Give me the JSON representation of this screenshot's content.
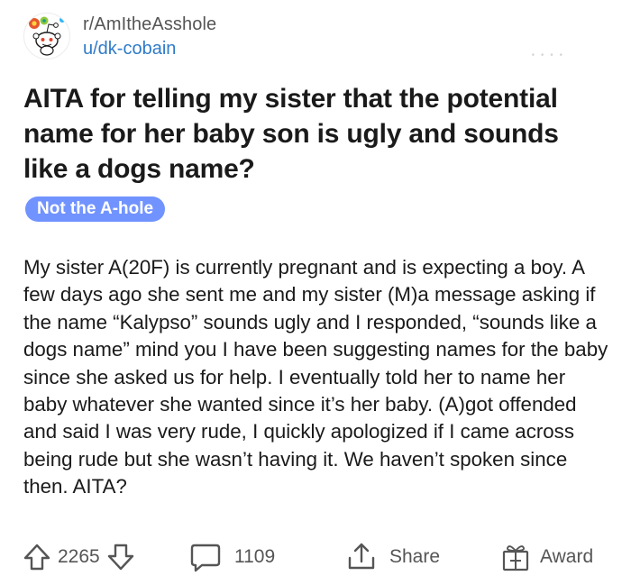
{
  "post": {
    "subreddit": "r/AmItheAsshole",
    "author": "u/dk-cobain",
    "title": "AITA for telling my sister that the potential name for her baby son is ugly and sounds like a dogs name?",
    "flair": "Not the A-hole",
    "body": "My sister A(20F) is currently pregnant and is expecting a boy. A few days ago she sent me and my sister (M)a message asking if the name “Kalypso” sounds ugly and I responded, “sounds like a dogs name” mind you I have been suggesting names for the baby since she asked us for help. I eventually told her to name her baby whatever she wanted since it’s her baby. (A)got offended and said I was very rude, I quickly apologized if I came across being rude but she wasn’t having it. We haven’t spoken since then. AITA?"
  },
  "actions": {
    "upvotes": "2265",
    "comments": "1109",
    "share_label": "Share",
    "award_label": "Award"
  },
  "colors": {
    "flair_bg": "#7193ff",
    "username": "#2f7bc9",
    "text": "#1a1a1b",
    "muted": "#555555"
  },
  "icons": {
    "avatar": "snoo-avatar-icon",
    "upvote": "upvote-arrow-icon",
    "downvote": "downvote-arrow-icon",
    "comment": "comment-bubble-icon",
    "share": "share-icon",
    "award": "gift-icon"
  }
}
